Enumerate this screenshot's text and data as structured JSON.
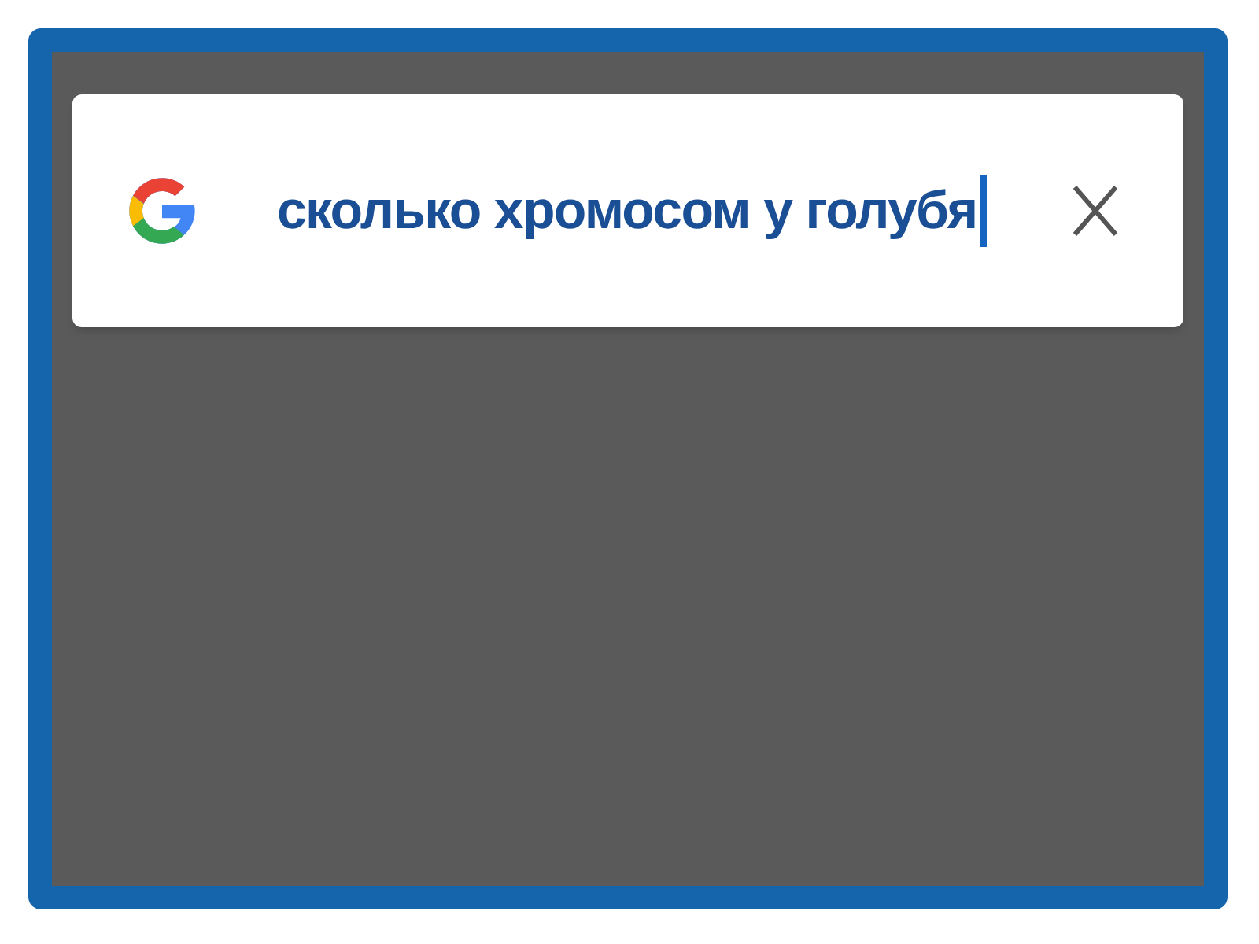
{
  "search": {
    "value": "сколько хромосом у голубя",
    "cursor": true
  }
}
